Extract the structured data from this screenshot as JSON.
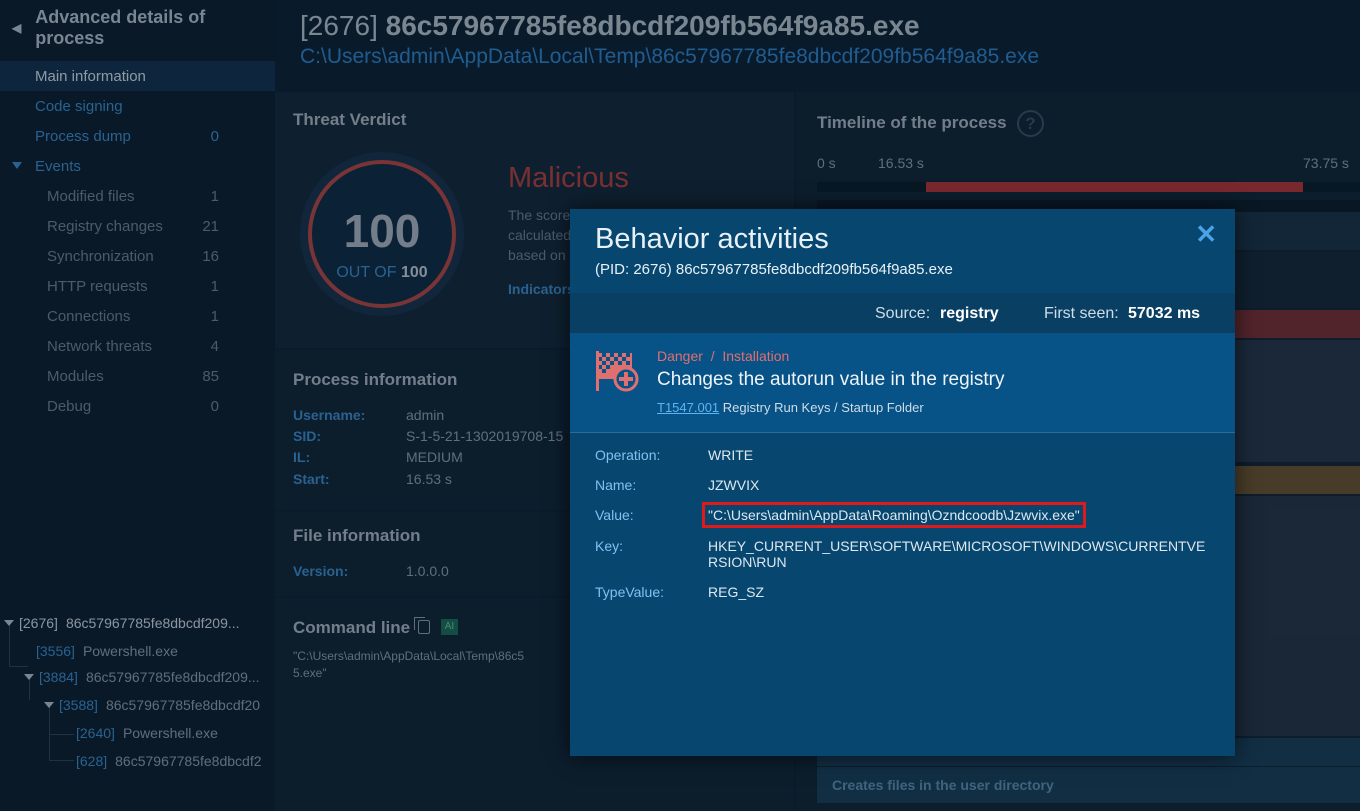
{
  "sidebar": {
    "title": "Advanced details of process",
    "items": [
      {
        "label": "Main information",
        "count": ""
      },
      {
        "label": "Code signing",
        "count": ""
      },
      {
        "label": "Process dump",
        "count": "0"
      },
      {
        "label": "Events",
        "count": ""
      },
      {
        "label": "Modified files",
        "count": "1"
      },
      {
        "label": "Registry changes",
        "count": "21"
      },
      {
        "label": "Synchronization",
        "count": "16"
      },
      {
        "label": "HTTP requests",
        "count": "1"
      },
      {
        "label": "Connections",
        "count": "1"
      },
      {
        "label": "Network threats",
        "count": "4"
      },
      {
        "label": "Modules",
        "count": "85"
      },
      {
        "label": "Debug",
        "count": "0"
      }
    ],
    "tree": [
      {
        "pid": "[2676]",
        "name": "86c57967785fe8dbcdf209..."
      },
      {
        "pid": "[3556]",
        "name": "Powershell.exe"
      },
      {
        "pid": "[3884]",
        "name": "86c57967785fe8dbcdf209..."
      },
      {
        "pid": "[3588]",
        "name": "86c57967785fe8dbcdf20"
      },
      {
        "pid": "[2640]",
        "name": "Powershell.exe"
      },
      {
        "pid": "[628]",
        "name": "86c57967785fe8dbcdf2"
      }
    ]
  },
  "header": {
    "pid": "[2676]",
    "filename": "86c57967785fe8dbcdf209fb564f9a85.exe",
    "path": "C:\\Users\\admin\\AppData\\Local\\Temp\\86c57967785fe8dbcdf209fb564f9a85.exe"
  },
  "verdict": {
    "title": "Threat Verdict",
    "score": "100",
    "out_of_label": "OUT OF",
    "out_of": "100",
    "label": "Malicious",
    "text_lines": [
      "The score",
      "calculated",
      "based on"
    ],
    "indicators": "Indicators"
  },
  "process_info": {
    "title": "Process information",
    "fields": [
      {
        "k": "Username:",
        "v": "admin"
      },
      {
        "k": "SID:",
        "v": "S-1-5-21-1302019708-15"
      },
      {
        "k": "IL:",
        "v": "MEDIUM"
      },
      {
        "k": "Start:",
        "v": "16.53 s"
      }
    ]
  },
  "file_info": {
    "title": "File information",
    "fields": [
      {
        "k": "Version:",
        "v": "1.0.0.0"
      }
    ]
  },
  "command_line": {
    "title": "Command line",
    "ai": "AI",
    "text": "\"C:\\Users\\admin\\AppData\\Local\\Temp\\86c5",
    "text2": "5.exe\""
  },
  "timeline": {
    "title": "Timeline of the process",
    "help": "?",
    "ticks": [
      "0 s",
      "16.53 s",
      "73.75 s"
    ],
    "progress_start": 0.224,
    "progress_end": 1.0,
    "bottom_item": "Creates files in the user directory"
  },
  "modal": {
    "title": "Behavior activities",
    "subtitle": "(PID: 2676) 86c57967785fe8dbcdf209fb564f9a85.exe",
    "close": "✕",
    "source_label": "Source:",
    "source": "registry",
    "first_seen_label": "First seen:",
    "first_seen": "57032 ms",
    "danger": "Danger",
    "sep": "/",
    "category": "Installation",
    "activity": "Changes the autorun value in the registry",
    "technique_id": "T1547.001",
    "technique_name": "Registry Run Keys / Startup Folder",
    "fields": {
      "operation_label": "Operation:",
      "operation": "WRITE",
      "name_label": "Name:",
      "name": "JZWVIX",
      "value_label": "Value:",
      "value": "\"C:\\Users\\admin\\AppData\\Roaming\\Ozndcoodb\\Jzwvix.exe\"",
      "key_label": "Key:",
      "key": "HKEY_CURRENT_USER\\SOFTWARE\\MICROSOFT\\WINDOWS\\CURRENTVERSION\\RUN",
      "typevalue_label": "TypeValue:",
      "typevalue": "REG_SZ"
    },
    "colors": {
      "danger": "#e07070",
      "highlight": "#e01a1a",
      "accent": "#4aa3e8"
    }
  }
}
